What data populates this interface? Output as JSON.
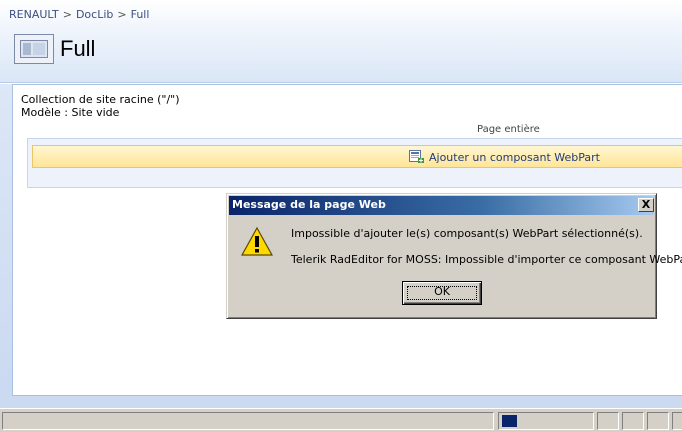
{
  "breadcrumb": {
    "items": [
      "RENAULT",
      "DocLib",
      "Full"
    ],
    "separator": ">"
  },
  "page": {
    "title": "Full"
  },
  "site_info": {
    "line1": "Collection de site racine (\"/\")",
    "line2": "Modèle : Site vide"
  },
  "zone": {
    "label": "Page entière",
    "add_webpart_label": "Ajouter un composant WebPart"
  },
  "dialog": {
    "title": "Message de la page Web",
    "close_label": "X",
    "message1": "Impossible d'ajouter le(s) composant(s) WebPart sélectionné(s).",
    "message2": "Telerik RadEditor for MOSS: Impossible d'importer ce composant WebPart.",
    "ok_label": "OK"
  },
  "colors": {
    "title_bar": "#0a246a",
    "highlight_bar": "#ffe596",
    "link": "#3b4f81"
  }
}
